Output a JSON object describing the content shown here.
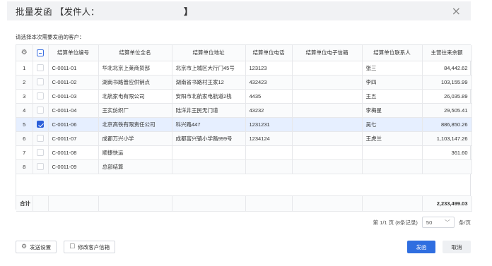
{
  "dialog": {
    "title": "批量发函",
    "bracket_open": "【",
    "sender_label": "发件人：",
    "bracket_close": "】",
    "close_icon": "×"
  },
  "hint": "请选择本次需要发函的客户：",
  "table": {
    "columns": [
      "结算单位编号",
      "结算单位全名",
      "结算单位地址",
      "结算单位电话",
      "结算单位电子信箱",
      "结算单位联系人",
      "主营往来余额"
    ],
    "settings_icon": "⚙",
    "rows": [
      {
        "index": "1",
        "checked": false,
        "code": "C-0011-01",
        "name": "华北北京上莱商贸部",
        "address": "北京市上城区大行门45号",
        "phone": "123123",
        "email": "",
        "contact": "张三",
        "balance": "84,442.62"
      },
      {
        "index": "2",
        "checked": false,
        "code": "C-0011-02",
        "name": "湖南书路普应供销点",
        "address": "湖南省书路村王家12",
        "phone": "432423",
        "email": "",
        "contact": "李四",
        "balance": "103,155.99"
      },
      {
        "index": "3",
        "checked": false,
        "code": "C-0011-03",
        "name": "北航家电有限公司",
        "address": "安阳市北航家电航道2栈",
        "phone": "4435",
        "email": "",
        "contact": "王五",
        "balance": "26,035.89"
      },
      {
        "index": "4",
        "checked": false,
        "code": "C-0011-04",
        "name": "王实纺织厂",
        "address": "陆洋井王民无门道",
        "phone": "43232",
        "email": "",
        "contact": "李梅星",
        "balance": "29,505.41"
      },
      {
        "index": "5",
        "checked": true,
        "code": "C-0011-06",
        "name": "北京高铁有限责任公司",
        "address": "科兴路447",
        "phone": "1231231",
        "email": "",
        "contact": "吴七",
        "balance": "886,850.26"
      },
      {
        "index": "6",
        "checked": false,
        "code": "C-0011-07",
        "name": "成都万兴小学",
        "address": "成都富兴镇小学路999号",
        "phone": "1234124",
        "email": "",
        "contact": "王虎兰",
        "balance": "1,103,147.26"
      },
      {
        "index": "7",
        "checked": false,
        "code": "C-0011-08",
        "name": "顺捷快运",
        "address": "",
        "phone": "",
        "email": "",
        "contact": "",
        "balance": "361.60"
      },
      {
        "index": "8",
        "checked": false,
        "code": "C-0011-09",
        "name": "总部结算",
        "address": "",
        "phone": "",
        "email": "",
        "contact": "",
        "balance": ""
      }
    ],
    "total_label": "合计",
    "total_balance": "2,233,499.03"
  },
  "pager": {
    "info": "第 1/1 页 (8条记录)",
    "page_size": "50",
    "unit": "条/页"
  },
  "footer": {
    "send_settings": "发送设置",
    "edit_email": "修改客户信箱",
    "send": "发函",
    "cancel": "取消"
  },
  "colors": {
    "primary": "#2f6ee0",
    "selected_row": "#e6efff",
    "header_bg": "#f1f2f4"
  }
}
